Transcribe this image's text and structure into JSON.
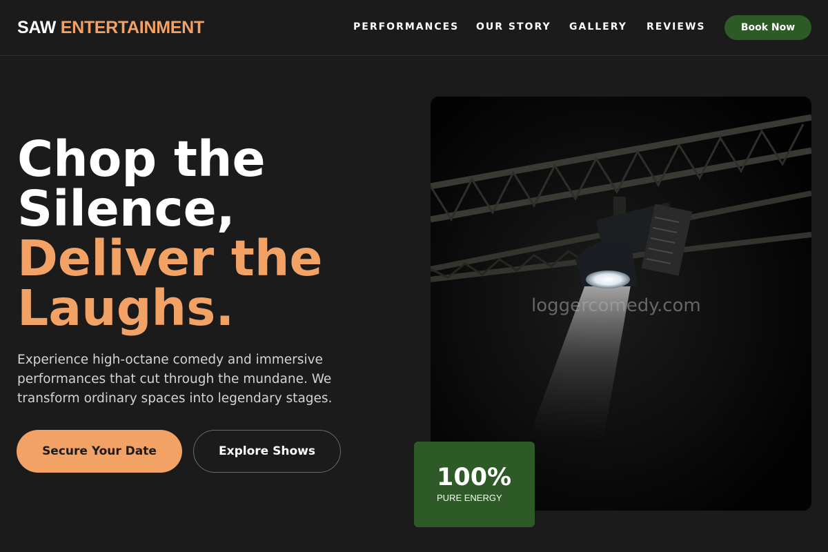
{
  "brand": {
    "name_white": "SAW",
    "name_accent": "ENTERTAINMENT"
  },
  "nav": {
    "items": [
      "PERFORMANCES",
      "OUR STORY",
      "GALLERY",
      "REVIEWS"
    ],
    "cta": "Book Now"
  },
  "hero": {
    "headline_line1": "Chop the",
    "headline_line2": "Silence,",
    "headline_line3": "Deliver the",
    "headline_line4": "Laughs.",
    "subtitle": "Experience high-octane comedy and immersive performances that cut through the mundane. We transform ordinary spaces into legendary stages.",
    "primary_button": "Secure Your Date",
    "secondary_button": "Explore Shows"
  },
  "image": {
    "subject": "stage-spotlight-icon",
    "watermark": "loggercomedy.com"
  },
  "stat": {
    "value": "100%",
    "label": "PURE ENERGY"
  },
  "colors": {
    "background": "#1b1b1b",
    "accent_orange": "#f2a264",
    "accent_green": "#2d5a27",
    "text": "#ffffff"
  }
}
